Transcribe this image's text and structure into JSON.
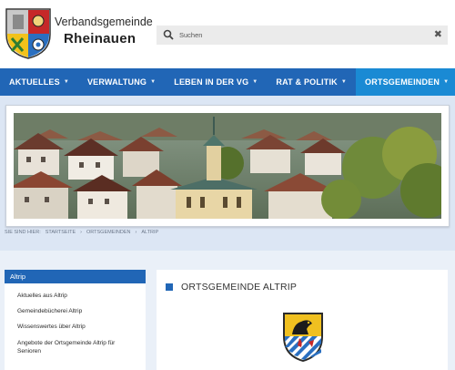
{
  "header": {
    "brand_top": "Verbandsgemeinde",
    "brand_main": "Rheinauen",
    "search": {
      "placeholder": "Suchen",
      "clear": "✖"
    }
  },
  "nav": {
    "items": [
      {
        "label": "AKTUELLES",
        "caret": "▼"
      },
      {
        "label": "VERWALTUNG",
        "caret": "▼"
      },
      {
        "label": "LEBEN IN DER VG",
        "caret": "▼"
      },
      {
        "label": "RAT & POLITIK",
        "caret": "▼"
      },
      {
        "label": "ORTSGEMEINDEN",
        "caret": "▼"
      }
    ]
  },
  "breadcrumb": [
    "SIE SIND HIER:",
    "STARTSEITE",
    "›",
    "ORTSGEMEINDEN",
    "›",
    "ALTRIP"
  ],
  "sidebar": {
    "title": "Altrip",
    "links": [
      "Aktuelles aus Altrip",
      "Gemeindebücherei Altrip",
      "Wissenswertes über Altrip",
      "Angebote der Ortsgemeinde Altrip für Senioren"
    ]
  },
  "main": {
    "title": "ORTSGEMEINDE ALTRIP"
  },
  "colors": {
    "nav": "#2166b6",
    "nav_active": "#1a8ad4",
    "accent": "#2166b6"
  }
}
